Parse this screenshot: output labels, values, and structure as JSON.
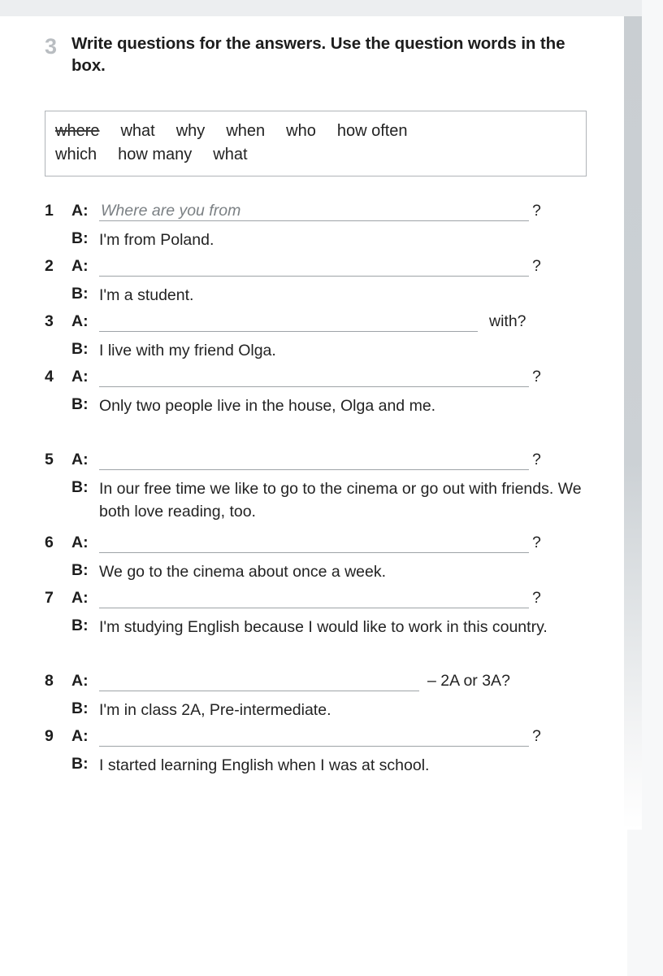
{
  "exercise": {
    "number": "3",
    "instruction": "Write questions for the answers. Use the question words in the box."
  },
  "word_box": {
    "rows": [
      [
        {
          "text": "where",
          "struck": true
        },
        {
          "text": "what",
          "struck": false
        },
        {
          "text": "why",
          "struck": false
        },
        {
          "text": "when",
          "struck": false
        },
        {
          "text": "who",
          "struck": false
        },
        {
          "text": "how often",
          "struck": false
        }
      ],
      [
        {
          "text": "which",
          "struck": false
        },
        {
          "text": "how many",
          "struck": false
        },
        {
          "text": "what",
          "struck": false
        }
      ]
    ]
  },
  "speakers": {
    "question": "A:",
    "answer": "B:"
  },
  "items": [
    {
      "number": "1",
      "example": "Where are you from",
      "rule": "full",
      "tail": "?",
      "tail_kind": "q",
      "answer": "I'm from Poland."
    },
    {
      "number": "2",
      "example": "",
      "rule": "full",
      "tail": "?",
      "tail_kind": "q",
      "answer": "I'm a student."
    },
    {
      "number": "3",
      "example": "",
      "rule": "short3",
      "tail": "with?",
      "tail_kind": "with",
      "answer": "I live with my friend Olga."
    },
    {
      "number": "4",
      "example": "",
      "rule": "full",
      "tail": "?",
      "tail_kind": "q",
      "answer": "Only two people live in the house, Olga and me."
    },
    {
      "number": "5",
      "example": "",
      "rule": "full",
      "tail": "?",
      "tail_kind": "q",
      "answer": "In our free time we like to go to the cinema or go out with friends. We both love reading, too."
    },
    {
      "number": "6",
      "example": "",
      "rule": "full",
      "tail": "?",
      "tail_kind": "q",
      "answer": "We go to the cinema about once a week."
    },
    {
      "number": "7",
      "example": "",
      "rule": "full",
      "tail": "?",
      "tail_kind": "q",
      "answer": "I'm studying English because I would like to work in this country."
    },
    {
      "number": "8",
      "example": "",
      "rule": "short8",
      "tail": "– 2A or 3A?",
      "tail_kind": "class",
      "answer": "I'm in class 2A, Pre-intermediate."
    },
    {
      "number": "9",
      "example": "",
      "rule": "full",
      "tail": "?",
      "tail_kind": "q",
      "answer": "I started learning English when I was at school."
    }
  ],
  "colors": {
    "page_background": "#ffffff",
    "outer_background": "#f7f8f9",
    "exercise_number": "#b9bdc1",
    "text": "#232323",
    "rule": "#9ea3a7",
    "box_border": "#b0b4b8",
    "example_text": "#7b8084",
    "gutter": "#c9ced2"
  }
}
